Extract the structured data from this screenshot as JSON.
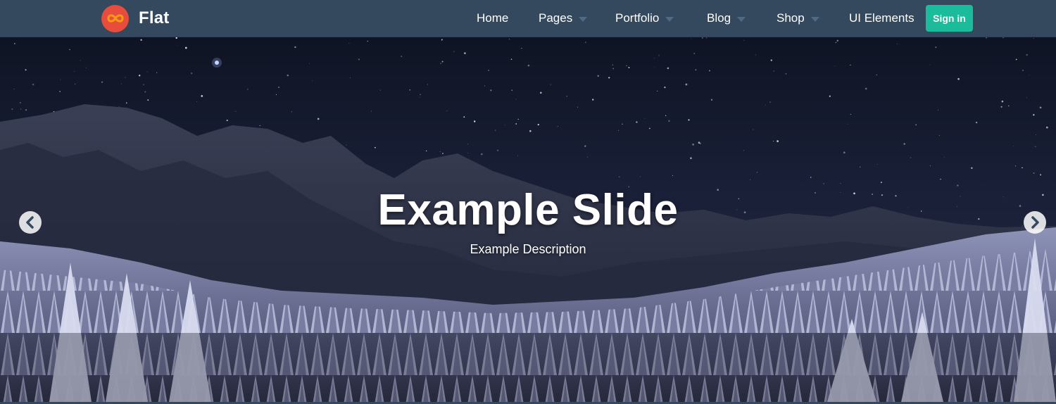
{
  "brand": {
    "name": "Flat",
    "logo_icon": "infinity-icon",
    "logo_color": "#e74c3c"
  },
  "nav": {
    "items": [
      {
        "label": "Home",
        "has_dropdown": false
      },
      {
        "label": "Pages",
        "has_dropdown": true
      },
      {
        "label": "Portfolio",
        "has_dropdown": true
      },
      {
        "label": "Blog",
        "has_dropdown": true
      },
      {
        "label": "Shop",
        "has_dropdown": true
      },
      {
        "label": "UI Elements",
        "has_dropdown": false
      }
    ],
    "signin_label": "Sign in",
    "background": "#34495e",
    "accent": "#1abc9c"
  },
  "slider": {
    "title": "Example Slide",
    "description": "Example Description",
    "prev_icon": "chevron-left-icon",
    "next_icon": "chevron-right-icon",
    "scene": "starry night sky over snowy mountain and frosted pine forest"
  }
}
